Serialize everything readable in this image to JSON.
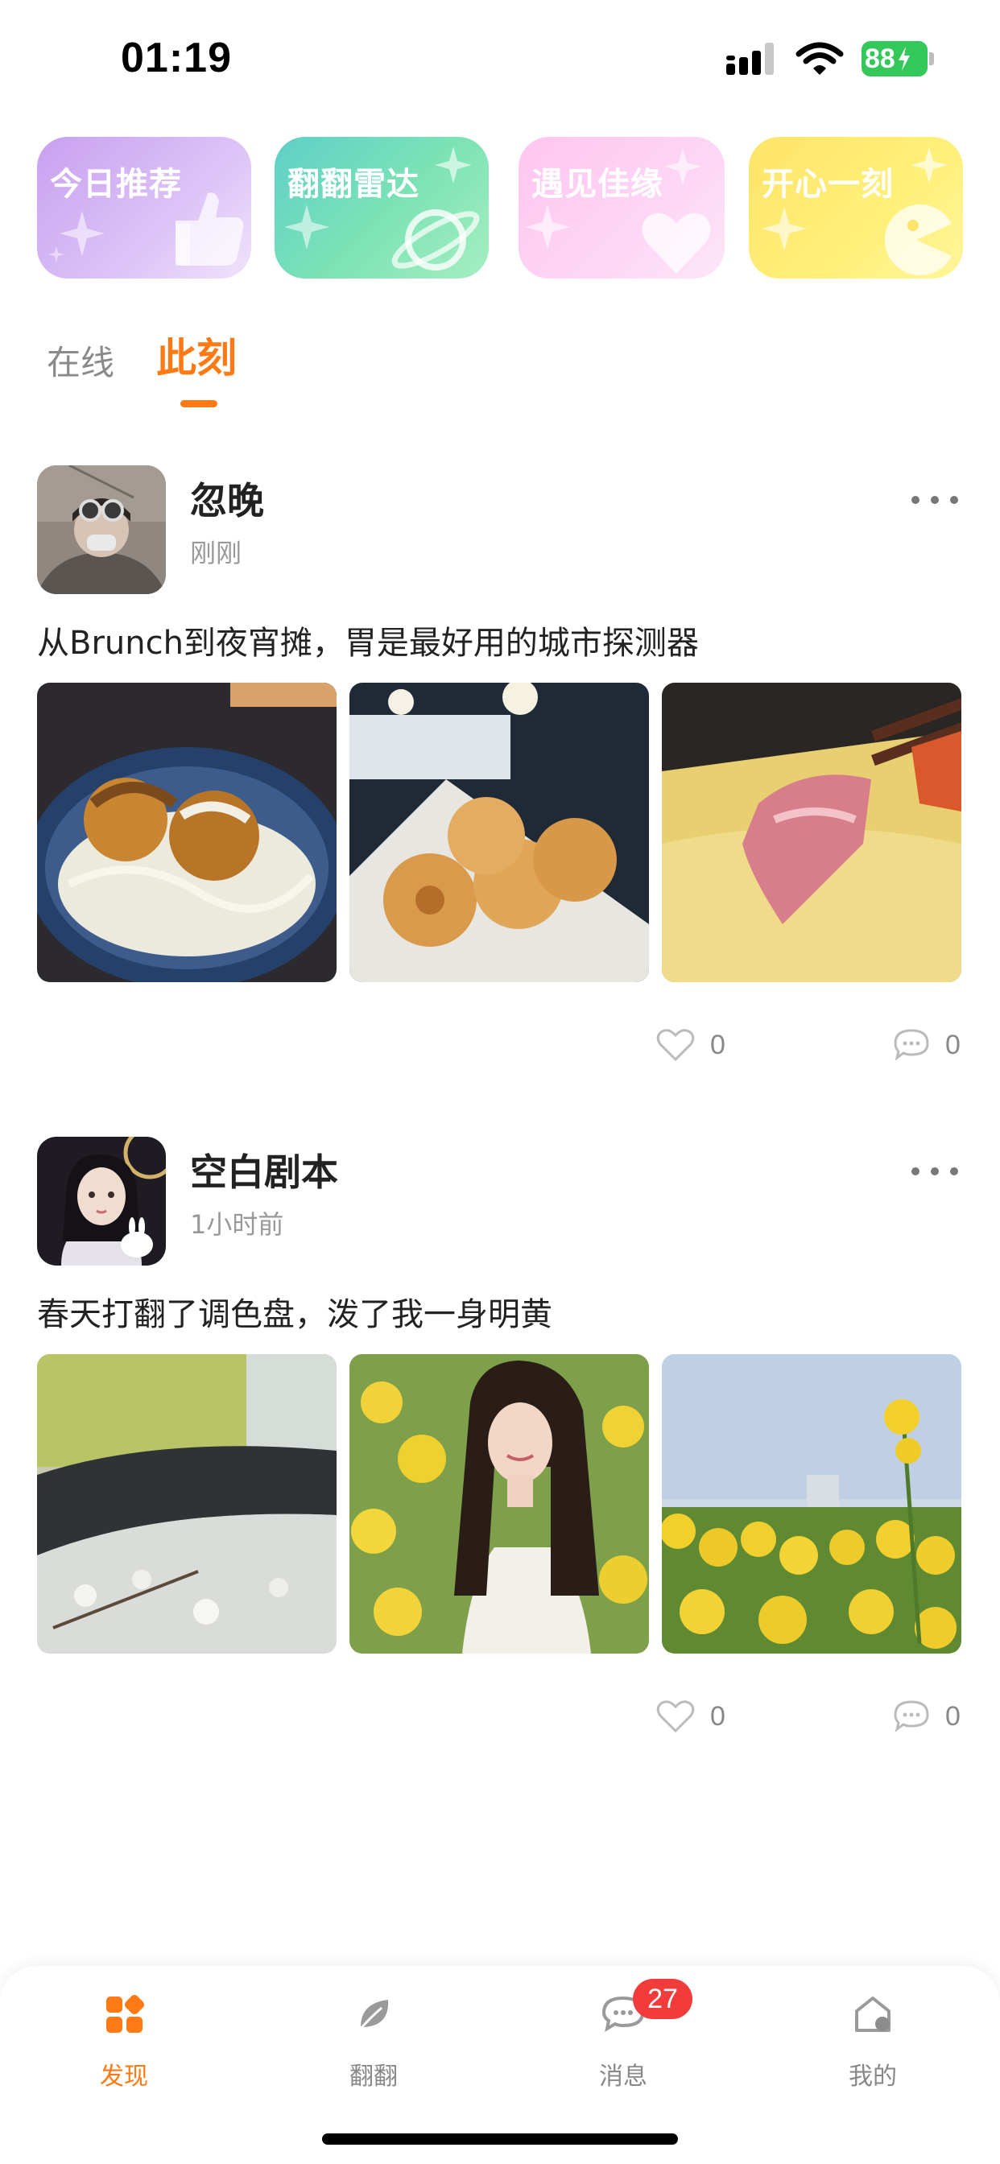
{
  "status_bar": {
    "time": "01:19",
    "battery": "88",
    "icons": [
      "signal-icon",
      "wifi-icon",
      "battery-charging-icon"
    ]
  },
  "shortcuts": [
    {
      "label": "今日推荐",
      "icon": "thumbs-up-icon",
      "color": "#c9a0f0"
    },
    {
      "label": "翻翻雷达",
      "icon": "planet-icon",
      "color": "#5ed0c8"
    },
    {
      "label": "遇见佳缘",
      "icon": "heart-icon",
      "color": "#ffc6f0"
    },
    {
      "label": "开心一刻",
      "icon": "pacman-icon",
      "color": "#ffe46a"
    }
  ],
  "feed_tabs": {
    "online": "在线",
    "now": "此刻",
    "active": "now",
    "accent": "#ff7a14"
  },
  "posts": [
    {
      "username": "忽晚",
      "time": "刚刚",
      "text": "从Brunch到夜宵摊，胃是最好用的城市探测器",
      "likes": "0",
      "comments": "0",
      "photos": [
        "takoyaki-photo",
        "fried-donuts-photo",
        "hotpot-meat-photo"
      ]
    },
    {
      "username": "空白剧本",
      "time": "1小时前",
      "text": "春天打翻了调色盘，泼了我一身明黄",
      "likes": "0",
      "comments": "0",
      "photos": [
        "blossom-railing-photo",
        "girl-in-rapeseed-field-photo",
        "rapeseed-flowers-photo"
      ]
    }
  ],
  "bottom_nav": {
    "items": [
      {
        "label": "发现",
        "icon": "grid-icon",
        "active": true
      },
      {
        "label": "翻翻",
        "icon": "leaf-icon",
        "active": false
      },
      {
        "label": "消息",
        "icon": "chat-bubble-icon",
        "active": false,
        "badge": "27"
      },
      {
        "label": "我的",
        "icon": "home-profile-icon",
        "active": false
      }
    ]
  }
}
